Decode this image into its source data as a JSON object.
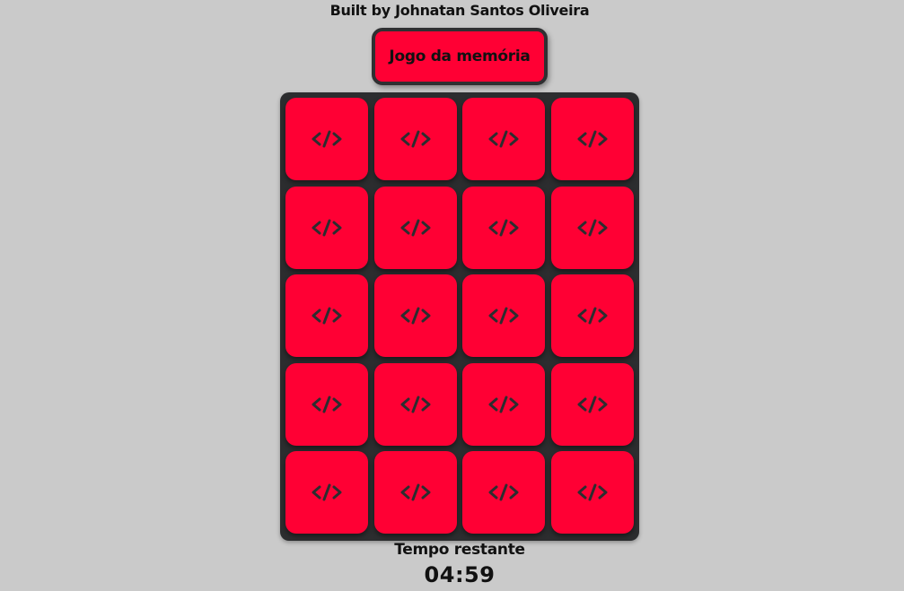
{
  "header": {
    "credit": "Built by Johnatan Santos Oliveira",
    "title": "Jogo da memória"
  },
  "board": {
    "rows": 5,
    "columns": 4,
    "card_back_icon": "code-icon",
    "card_back_icon_text": "</>",
    "card_color": "#ff0034",
    "board_color": "#2c2d2f",
    "cards_face_down": 20
  },
  "timer": {
    "label": "Tempo restante",
    "value": "04:59"
  },
  "colors": {
    "background": "#cacaca",
    "accent": "#ff0034",
    "text": "#111111"
  }
}
